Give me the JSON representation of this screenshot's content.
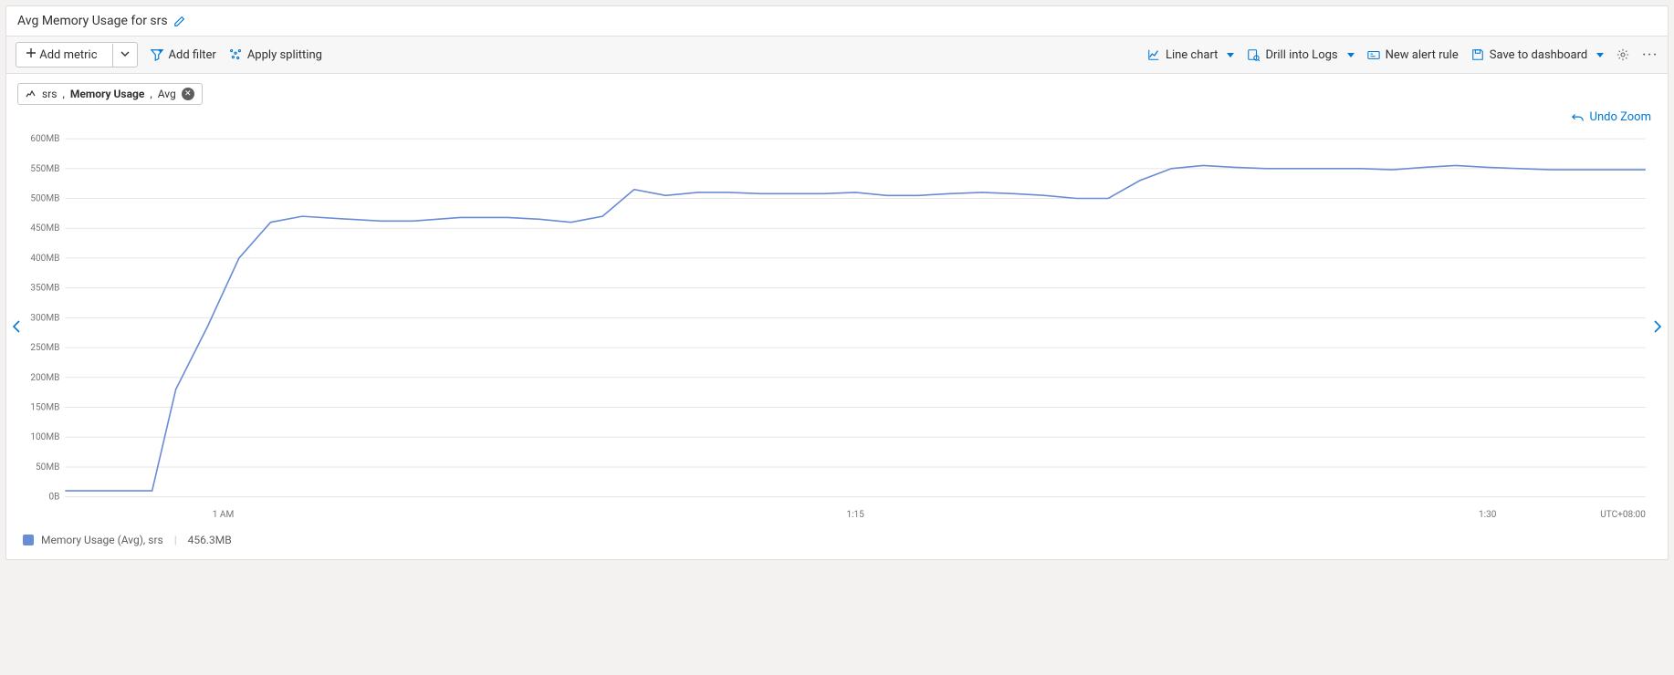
{
  "title": "Avg Memory Usage for srs",
  "toolbar": {
    "add_metric": "Add metric",
    "add_filter": "Add filter",
    "apply_splitting": "Apply splitting",
    "line_chart": "Line chart",
    "drill_logs": "Drill into Logs",
    "new_alert": "New alert rule",
    "save_dash": "Save to dashboard"
  },
  "chip": {
    "resource": "srs",
    "metric": "Memory Usage",
    "agg": "Avg"
  },
  "undo_zoom": "Undo Zoom",
  "chart_data": {
    "type": "line",
    "title": "Avg Memory Usage for srs",
    "xlabel": "",
    "ylabel": "",
    "ylim": [
      0,
      600
    ],
    "y_unit": "MB",
    "y_ticks": [
      0,
      50,
      100,
      150,
      200,
      250,
      300,
      350,
      400,
      450,
      500,
      550,
      600
    ],
    "x_tick_labels": [
      "1 AM",
      "1:15",
      "1:30"
    ],
    "x_tick_positions": [
      0.1,
      0.5,
      0.9
    ],
    "tz_label": "UTC+08:00",
    "series": [
      {
        "name": "Memory Usage (Avg), srs",
        "x": [
          0.0,
          0.035,
          0.055,
          0.07,
          0.09,
          0.11,
          0.13,
          0.15,
          0.18,
          0.2,
          0.22,
          0.25,
          0.28,
          0.3,
          0.32,
          0.34,
          0.36,
          0.38,
          0.4,
          0.42,
          0.44,
          0.46,
          0.48,
          0.5,
          0.52,
          0.54,
          0.56,
          0.58,
          0.6,
          0.62,
          0.64,
          0.66,
          0.68,
          0.7,
          0.72,
          0.74,
          0.76,
          0.78,
          0.8,
          0.82,
          0.84,
          0.86,
          0.88,
          0.9,
          0.92,
          0.94,
          0.96,
          0.98,
          1.0
        ],
        "values": [
          10,
          10,
          10,
          180,
          285,
          400,
          460,
          470,
          465,
          462,
          462,
          468,
          468,
          465,
          460,
          470,
          515,
          505,
          510,
          510,
          508,
          508,
          508,
          510,
          505,
          505,
          508,
          510,
          508,
          505,
          500,
          500,
          530,
          550,
          555,
          552,
          550,
          550,
          550,
          550,
          548,
          552,
          555,
          552,
          550,
          548,
          548,
          548,
          548
        ]
      }
    ]
  },
  "legend": {
    "label": "Memory Usage (Avg), srs",
    "value": "456.3MB"
  },
  "colors": {
    "line": "#6a8cd7",
    "blue": "#0078d4"
  }
}
